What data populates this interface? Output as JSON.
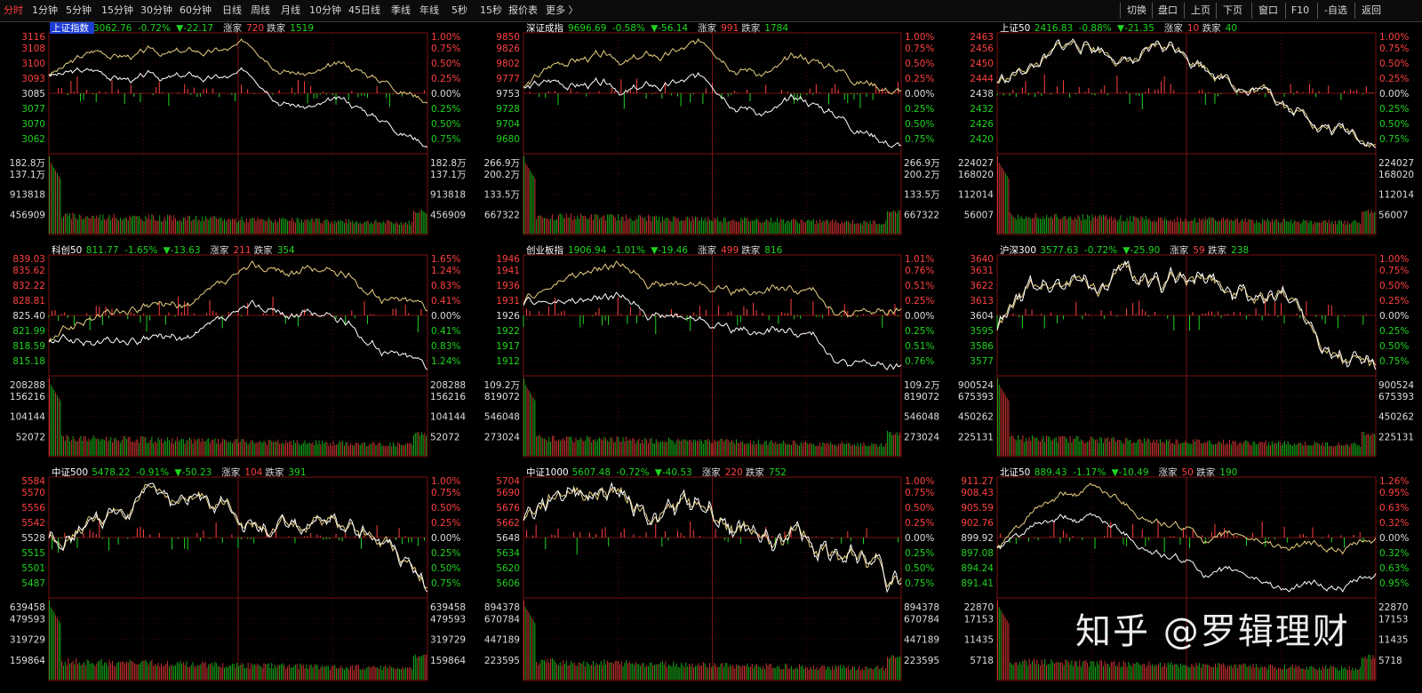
{
  "toolbar": {
    "left_items": [
      "分时",
      "1分钟",
      "5分钟",
      "15分钟",
      "30分钟",
      "60分钟",
      "日线",
      "周线",
      "月线",
      "10分钟",
      "45日线",
      "季线",
      "年线",
      "5秒",
      "15秒",
      "报价表",
      "更多 〉"
    ],
    "active_index": 0,
    "right_items": [
      "切换",
      "盘口",
      "上页",
      "下页",
      "窗口",
      "F10",
      "-自选",
      "返回"
    ]
  },
  "colors": {
    "up": "#ff4040",
    "down": "#1fd41f",
    "grid": "#7a1010",
    "line_white": "#ffffff",
    "line_yellow": "#e8d080",
    "volume": "#c8c8c8"
  },
  "panels": [
    {
      "id": "shanghai",
      "name": "上证指数",
      "name_highlight": true,
      "price": "3062.76",
      "pct": "-0.72%",
      "chg": "▼-22.17",
      "up_label": "涨家",
      "up_count": "720",
      "down_label": "跌家",
      "down_count": "1519",
      "price_ticks": [
        "3116",
        "3108",
        "3100",
        "3093",
        "3085",
        "3077",
        "3070",
        "3062"
      ],
      "pct_ticks": [
        "1.00%",
        "0.75%",
        "0.50%",
        "0.25%",
        "0.00%",
        "0.25%",
        "0.50%",
        "0.75%"
      ],
      "vol_ticks_left": [
        "182.8万",
        "137.1万",
        "913818",
        "456909"
      ],
      "vol_ticks_right": [
        "182.8万",
        "137.1万",
        "913818",
        "456909"
      ],
      "style": "diverge"
    },
    {
      "id": "shenzhen",
      "name": "深证成指",
      "name_highlight": false,
      "price": "9696.69",
      "pct": "-0.58%",
      "chg": "▼-56.14",
      "up_label": "涨家",
      "up_count": "991",
      "down_label": "跌家",
      "down_count": "1784",
      "price_ticks": [
        "9850",
        "9826",
        "9802",
        "9777",
        "9753",
        "9728",
        "9704",
        "9680"
      ],
      "pct_ticks": [
        "1.00%",
        "0.75%",
        "0.50%",
        "0.25%",
        "0.00%",
        "0.25%",
        "0.50%",
        "0.75%"
      ],
      "vol_ticks_left": [
        "266.9万",
        "200.2万",
        "133.5万",
        "667322"
      ],
      "vol_ticks_right": [
        "266.9万",
        "200.2万",
        "133.5万",
        "667322"
      ],
      "style": "diverge"
    },
    {
      "id": "sz50",
      "name": "上证50",
      "name_highlight": false,
      "price": "2416.83",
      "pct": "-0.88%",
      "chg": "▼-21.35",
      "up_label": "涨家",
      "up_count": "10",
      "down_label": "跌家",
      "down_count": "40",
      "price_ticks": [
        "2463",
        "2456",
        "2450",
        "2444",
        "2438",
        "2432",
        "2426",
        "2420"
      ],
      "pct_ticks": [
        "1.00%",
        "0.75%",
        "0.50%",
        "0.25%",
        "0.00%",
        "0.25%",
        "0.50%",
        "0.75%"
      ],
      "vol_ticks_left": [
        "224027",
        "168020",
        "112014",
        "56007"
      ],
      "vol_ticks_right": [
        "224027",
        "168020",
        "112014",
        "56007"
      ],
      "style": "together"
    },
    {
      "id": "kc50",
      "name": "科创50",
      "name_highlight": false,
      "price": "811.77",
      "pct": "-1.65%",
      "chg": "▼-13.63",
      "up_label": "涨家",
      "up_count": "211",
      "down_label": "跌家",
      "down_count": "354",
      "price_ticks": [
        "839.03",
        "835.62",
        "832.22",
        "828.81",
        "825.40",
        "821.99",
        "818.59",
        "815.18"
      ],
      "pct_ticks": [
        "1.65%",
        "1.24%",
        "0.83%",
        "0.41%",
        "0.00%",
        "0.41%",
        "0.83%",
        "1.24%"
      ],
      "vol_ticks_left": [
        "208288",
        "156216",
        "104144",
        "52072"
      ],
      "vol_ticks_right": [
        "208288",
        "156216",
        "104144",
        "52072"
      ],
      "style": "diverge"
    },
    {
      "id": "cyb",
      "name": "创业板指",
      "name_highlight": false,
      "price": "1906.94",
      "pct": "-1.01%",
      "chg": "▼-19.46",
      "up_label": "涨家",
      "up_count": "499",
      "down_label": "跌家",
      "down_count": "816",
      "price_ticks": [
        "1946",
        "1941",
        "1936",
        "1931",
        "1926",
        "1922",
        "1917",
        "1912"
      ],
      "pct_ticks": [
        "1.01%",
        "0.76%",
        "0.51%",
        "0.25%",
        "0.00%",
        "0.25%",
        "0.51%",
        "0.76%"
      ],
      "vol_ticks_left": [
        "109.2万",
        "819072",
        "546048",
        "273024"
      ],
      "vol_ticks_right": [
        "109.2万",
        "819072",
        "546048",
        "273024"
      ],
      "style": "diverge"
    },
    {
      "id": "hs300",
      "name": "沪深300",
      "name_highlight": false,
      "price": "3577.63",
      "pct": "-0.72%",
      "chg": "▼-25.90",
      "up_label": "涨家",
      "up_count": "59",
      "down_label": "跌家",
      "down_count": "238",
      "price_ticks": [
        "3640",
        "3631",
        "3622",
        "3613",
        "3604",
        "3595",
        "3586",
        "3577"
      ],
      "pct_ticks": [
        "1.00%",
        "0.75%",
        "0.50%",
        "0.25%",
        "0.00%",
        "0.25%",
        "0.50%",
        "0.75%"
      ],
      "vol_ticks_left": [
        "900524",
        "675393",
        "450262",
        "225131"
      ],
      "vol_ticks_right": [
        "900524",
        "675393",
        "450262",
        "225131"
      ],
      "style": "together"
    },
    {
      "id": "zz500",
      "name": "中证500",
      "name_highlight": false,
      "price": "5478.22",
      "pct": "-0.91%",
      "chg": "▼-50.23",
      "up_label": "涨家",
      "up_count": "104",
      "down_label": "跌家",
      "down_count": "391",
      "price_ticks": [
        "5584",
        "5570",
        "5556",
        "5542",
        "5528",
        "5515",
        "5501",
        "5487"
      ],
      "pct_ticks": [
        "1.00%",
        "0.75%",
        "0.50%",
        "0.25%",
        "0.00%",
        "0.25%",
        "0.50%",
        "0.75%"
      ],
      "vol_ticks_left": [
        "639458",
        "479593",
        "319729",
        "159864"
      ],
      "vol_ticks_right": [
        "639458",
        "479593",
        "319729",
        "159864"
      ],
      "style": "together"
    },
    {
      "id": "zz1000",
      "name": "中证1000",
      "name_highlight": false,
      "price": "5607.48",
      "pct": "-0.72%",
      "chg": "▼-40.53",
      "up_label": "涨家",
      "up_count": "220",
      "down_label": "跌家",
      "down_count": "752",
      "price_ticks": [
        "5704",
        "5690",
        "5676",
        "5662",
        "5648",
        "5634",
        "5620",
        "5606"
      ],
      "pct_ticks": [
        "1.00%",
        "0.75%",
        "0.50%",
        "0.25%",
        "0.00%",
        "0.25%",
        "0.50%",
        "0.75%"
      ],
      "vol_ticks_left": [
        "894378",
        "670784",
        "447189",
        "223595"
      ],
      "vol_ticks_right": [
        "894378",
        "670784",
        "447189",
        "223595"
      ],
      "style": "together"
    },
    {
      "id": "bz50",
      "name": "北证50",
      "name_highlight": false,
      "price": "889.43",
      "pct": "-1.17%",
      "chg": "▼-10.49",
      "up_label": "涨家",
      "up_count": "50",
      "down_label": "跌家",
      "down_count": "190",
      "price_ticks": [
        "911.27",
        "908.43",
        "905.59",
        "902.76",
        "899.92",
        "897.08",
        "894.24",
        "891.41"
      ],
      "pct_ticks": [
        "1.26%",
        "0.95%",
        "0.63%",
        "0.32%",
        "0.00%",
        "0.32%",
        "0.63%",
        "0.95%"
      ],
      "vol_ticks_left": [
        "22870",
        "17153",
        "11435",
        "5718"
      ],
      "vol_ticks_right": [
        "22870",
        "17153",
        "11435",
        "5718"
      ],
      "style": "bz"
    }
  ],
  "watermark": "知乎 @罗辑理财"
}
